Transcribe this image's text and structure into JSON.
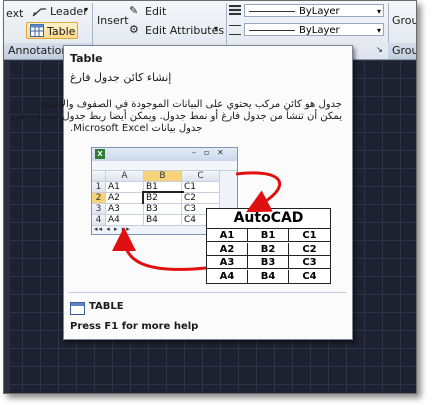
{
  "ribbon": {
    "text_label": "ext",
    "leader_label": "Leader",
    "table_label": "Table",
    "insert_label": "Insert",
    "edit_label": "Edit",
    "edit_attributes_label": "Edit Attributes",
    "annotation_panel": "Annotation",
    "group_label": "Group",
    "group_panel_label": "Group",
    "layer_value_1": "ByLayer",
    "layer_value_2": "ByLayer"
  },
  "tooltip": {
    "title": "Table",
    "subtitle_ar": "إنشاء كائن جدول فارغ",
    "desc_line1": "جدول هو كائن مركب يحتوي على البيانات الموجودة في الصفوف والأعمدة.",
    "desc_line2": "يمكن أن تنشأ من جدول فارغ أو نمط جدول. ويمكن أيضا ربط جدول للبيانات في",
    "desc_line3": "جدول بيانات Microsoft Excel.",
    "command_name": "TABLE",
    "help_text": "Press F1 for more help"
  },
  "excel": {
    "columns": [
      "A",
      "B",
      "C"
    ],
    "rows": [
      {
        "num": "1",
        "cells": [
          "A1",
          "B1",
          "C1"
        ]
      },
      {
        "num": "2",
        "cells": [
          "A2",
          "B2",
          "C2"
        ]
      },
      {
        "num": "3",
        "cells": [
          "A3",
          "B3",
          "C3"
        ]
      },
      {
        "num": "4",
        "cells": [
          "A4",
          "B4",
          "C4"
        ]
      }
    ]
  },
  "autocad_table": {
    "title": "AutoCAD",
    "rows": [
      [
        "A1",
        "B1",
        "C1"
      ],
      [
        "A2",
        "B2",
        "C2"
      ],
      [
        "A3",
        "B3",
        "C3"
      ],
      [
        "A4",
        "B4",
        "C4"
      ]
    ]
  },
  "colors": {
    "canvas_bg": "#1e2230",
    "arrow": "#e01010",
    "excel_selected_header": "#f6d27a"
  }
}
